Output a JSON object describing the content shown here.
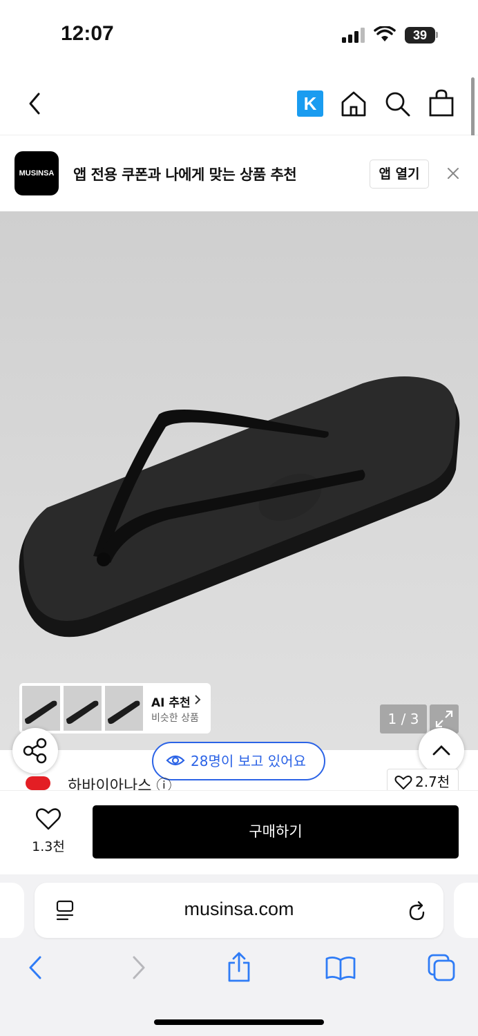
{
  "status_bar": {
    "time": "12:07",
    "battery": "39"
  },
  "nav": {
    "k_label": "K",
    "icons": [
      "back-arrow-icon",
      "home-icon",
      "search-icon",
      "shopping-bag-icon"
    ]
  },
  "banner": {
    "logo_text": "MUSINSA",
    "text": "앱 전용 쿠폰과 나에게 맞는 상품 추천",
    "open_button": "앱 열기"
  },
  "gallery": {
    "ai_title": "AI 추천",
    "ai_subtitle": "비슷한 상품",
    "counter": "1 / 3"
  },
  "viewers": {
    "text": "28명이 보고 있어요"
  },
  "brand": {
    "name": "하바이아나스 ⓘ",
    "likes": "2.7천"
  },
  "buy_bar": {
    "like_count": "1.3천",
    "buy_label": "구매하기"
  },
  "safari": {
    "url": "musinsa.com"
  },
  "colors": {
    "accent_blue": "#2b63e6",
    "brand_k": "#1a9cf0",
    "safari_blue": "#2f7cf6"
  }
}
